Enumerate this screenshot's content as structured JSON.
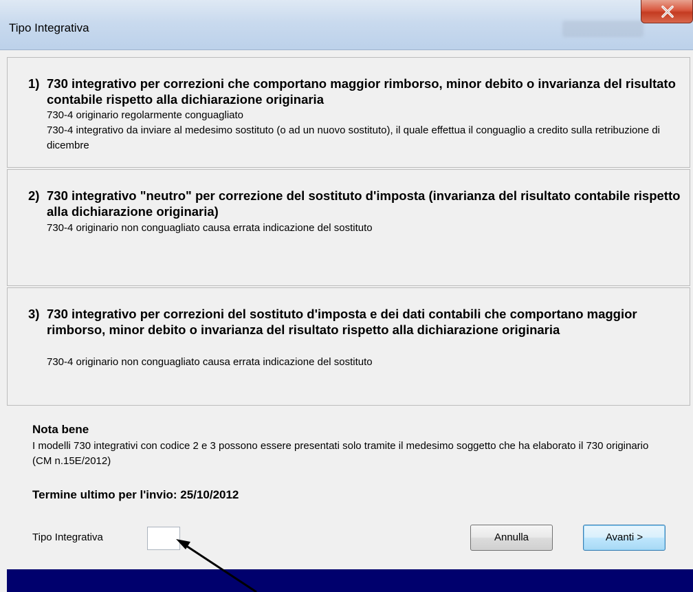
{
  "window": {
    "title": "Tipo Integrativa"
  },
  "options": [
    {
      "number": "1)",
      "heading": "730 integrativo per correzioni che comportano maggior rimborso, minor debito o invarianza del risultato contabile rispetto alla dichiarazione originaria",
      "lines": [
        "730-4 originario regolarmente conguagliato",
        "730-4 integrativo da inviare al medesimo sostituto (o ad un nuovo sostituto), il quale effettua il conguaglio a credito sulla retribuzione di dicembre"
      ]
    },
    {
      "number": "2)",
      "heading": "730 integrativo \"neutro\" per correzione del sostituto d'imposta (invarianza del risultato contabile rispetto alla dichiarazione originaria)",
      "lines": [
        "730-4 originario non conguagliato causa errata indicazione del sostituto"
      ]
    },
    {
      "number": "3)",
      "heading": "730 integrativo per correzioni del sostituto d'imposta e dei dati contabili che comportano maggior rimborso, minor debito o invarianza del risultato rispetto alla dichiarazione originaria",
      "lines": [
        "730-4 originario non conguagliato causa errata indicazione del sostituto"
      ]
    }
  ],
  "note": {
    "title": "Nota bene",
    "text": "I modelli 730 integrativi con codice 2 e 3 possono essere presentati solo tramite il medesimo soggetto che ha elaborato il 730 originario (CM n.15E/2012)"
  },
  "deadline": "Termine ultimo per l'invio: 25/10/2012",
  "form": {
    "tipo_label": "Tipo Integrativa",
    "tipo_value": ""
  },
  "buttons": {
    "cancel": "Annulla",
    "next": "Avanti >"
  },
  "icons": {
    "close": "close-icon"
  },
  "colors": {
    "close_button": "#c8442a",
    "bottom_bar": "#00006d",
    "default_button_border": "#3c7fb1"
  }
}
